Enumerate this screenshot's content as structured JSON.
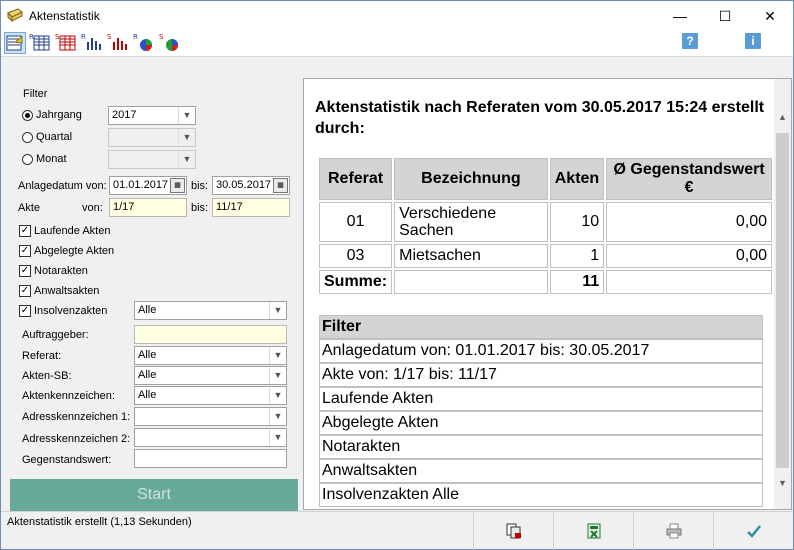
{
  "window": {
    "title": "Aktenstatistik",
    "minimize": "—",
    "maximize": "☐",
    "close": "✕"
  },
  "toolbar": {
    "icons": [
      "statistics-wizard-icon",
      "referat-table-icon",
      "sb-table-icon",
      "referat-bar-chart-icon",
      "sb-bar-chart-icon",
      "referat-pie-chart-icon",
      "sb-pie-chart-icon"
    ],
    "help_label": "?",
    "info_label": "i"
  },
  "filter": {
    "heading": "Filter",
    "jahrgang_label": "Jahrgang",
    "jahrgang_value": "2017",
    "quartal_label": "Quartal",
    "monat_label": "Monat",
    "anlagedatum_label": "Anlagedatum von:",
    "anlagedatum_from": "01.01.2017",
    "bis_label": "bis:",
    "anlagedatum_to": "30.05.2017",
    "akte_label": "Akte",
    "von_label": "von:",
    "akte_from": "1/17",
    "akte_bis_label": "bis:",
    "akte_to": "11/17",
    "laufende": "Laufende Akten",
    "abgelegte": "Abgelegte Akten",
    "notar": "Notarakten",
    "anwalt": "Anwaltsakten",
    "insolvenz": "Insolvenzakten",
    "insolvenz_value": "Alle",
    "auftraggeber_label": "Auftraggeber:",
    "referat_label": "Referat:",
    "referat_value": "Alle",
    "aktensb_label": "Akten-SB:",
    "aktensb_value": "Alle",
    "aktenkz_label": "Aktenkennzeichen:",
    "aktenkz_value": "Alle",
    "adresskz1_label": "Adresskennzeichen 1:",
    "adresskz2_label": "Adresskennzeichen 2:",
    "gegenstandswert_label": "Gegenstandswert:",
    "start_label": "Start"
  },
  "report": {
    "title": "Aktenstatistik nach Referaten vom 30.05.2017 15:24 erstellt durch:",
    "columns": [
      "Referat",
      "Bezeichnung",
      "Akten",
      "Ø Gegenstandswert €"
    ],
    "rows": [
      [
        "01",
        "Verschiedene Sachen",
        "10",
        "0,00"
      ],
      [
        "03",
        "Mietsachen",
        "1",
        "0,00"
      ]
    ],
    "sum_label": "Summe:",
    "sum_value": "11",
    "filter_heading": "Filter",
    "filter_items": [
      "Anlagedatum von: 01.01.2017 bis: 30.05.2017",
      "Akte von: 1/17 bis: 11/17",
      "Laufende Akten",
      "Abgelegte Akten",
      "Notarakten",
      "Anwaltsakten",
      "Insolvenzakten Alle"
    ]
  },
  "status": {
    "text": "Aktenstatistik erstellt (1,13 Sekunden)"
  }
}
